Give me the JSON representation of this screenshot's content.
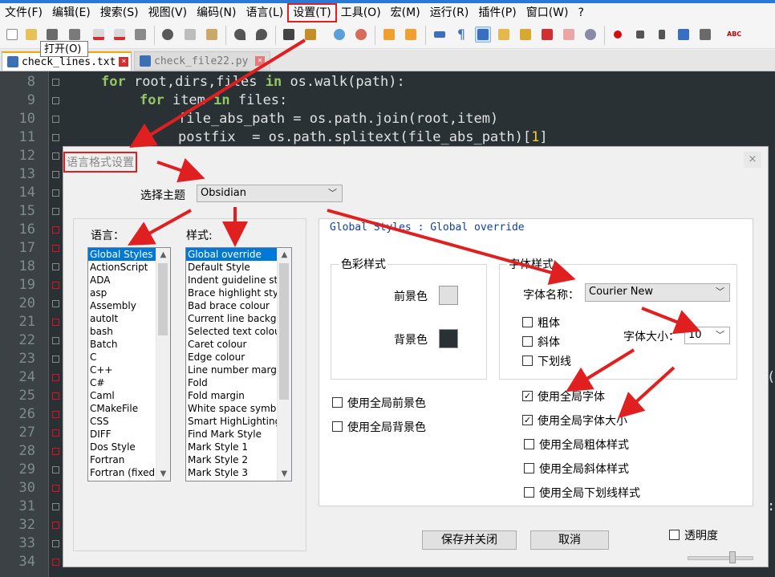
{
  "menubar": {
    "items": [
      "文件(F)",
      "编辑(E)",
      "搜索(S)",
      "视图(V)",
      "编码(N)",
      "语言(L)",
      "设置(T)",
      "工具(O)",
      "宏(M)",
      "运行(R)",
      "插件(P)",
      "窗口(W)",
      "?"
    ],
    "highlighted": "设置(T)"
  },
  "tooltip": "打开(O)",
  "tabs": [
    {
      "label": "check_lines.txt",
      "active": true
    },
    {
      "label": "check_file22.py",
      "active": false
    }
  ],
  "editor": {
    "lines": [
      {
        "n": "8"
      },
      {
        "n": "9"
      },
      {
        "n": "10"
      },
      {
        "n": "11"
      },
      {
        "n": "12"
      },
      {
        "n": "13"
      },
      {
        "n": "14"
      },
      {
        "n": "15"
      },
      {
        "n": "16"
      },
      {
        "n": "17"
      },
      {
        "n": "18"
      },
      {
        "n": "19"
      },
      {
        "n": "20"
      },
      {
        "n": "21"
      },
      {
        "n": "22"
      },
      {
        "n": "23"
      },
      {
        "n": "24"
      },
      {
        "n": "25"
      },
      {
        "n": "26"
      },
      {
        "n": "27"
      },
      {
        "n": "28"
      },
      {
        "n": "29"
      },
      {
        "n": "30"
      },
      {
        "n": "31"
      },
      {
        "n": "32"
      },
      {
        "n": "33"
      },
      {
        "n": "34"
      }
    ],
    "code": {
      "l8_kw1": "for",
      "l8_a": " root,dirs,files ",
      "l8_kw2": "in",
      "l8_b": " os.walk(path):",
      "l9_kw1": "for",
      "l9_a": " item ",
      "l9_kw2": "in",
      "l9_b": " files:",
      "l10": "file_abs_path = os.path.join(root,item)",
      "l11_a": "postfix  = os.path.splitext(file_abs_path)[",
      "l11_num": "1",
      "l11_b": "]"
    },
    "right_glyph_24": "(",
    "right_glyph_31": ":"
  },
  "dialog": {
    "title": "语言格式设置",
    "theme_label": "选择主题",
    "theme_value": "Obsidian",
    "language_label": "语言：",
    "style_label": "样式:",
    "languages": [
      "Global Styles",
      "ActionScript",
      "ADA",
      "asp",
      "Assembly",
      "autoIt",
      "bash",
      "Batch",
      "C",
      "C++",
      "C#",
      "Caml",
      "CMakeFile",
      "CSS",
      "DIFF",
      "Dos Style",
      "Fortran",
      "Fortran (fixed form)"
    ],
    "styles": [
      "Global override",
      "Default Style",
      "Indent guideline style",
      "Brace highlight style",
      "Bad brace colour",
      "Current line background colour",
      "Selected text colour",
      "Caret colour",
      "Edge colour",
      "Line number margin",
      "Fold",
      "Fold margin",
      "White space symbol",
      "Smart HighLighting",
      "Find Mark Style",
      "Mark Style 1",
      "Mark Style 2",
      "Mark Style 3"
    ],
    "panel_heading": "Global Styles : Global override",
    "color_group": "色彩样式",
    "fg_label": "前景色",
    "bg_label": "背景色",
    "fg_color": "#e0e0e0",
    "bg_color": "#293134",
    "font_group": "字体样式",
    "font_name_label": "字体名称：",
    "font_name_value": "Courier New",
    "font_size_label": "字体大小：",
    "font_size_value": "10",
    "bold_label": "粗体",
    "italic_label": "斜体",
    "underline_label": "下划线",
    "use_global_fg": "使用全局前景色",
    "use_global_bg": "使用全局背景色",
    "use_global_font": "使用全局字体",
    "use_global_font_size": "使用全局字体大小",
    "use_global_bold": "使用全局粗体样式",
    "use_global_italic": "使用全局斜体样式",
    "use_global_underline": "使用全局下划线样式",
    "checks": {
      "global_font": true,
      "global_font_size": true
    },
    "save_button": "保存并关闭",
    "cancel_button": "取消",
    "transparency_label": "透明度",
    "close_glyph": "×"
  },
  "accent_colors": {
    "annotation_red": "#e02020",
    "selection_blue": "#0078d7"
  }
}
